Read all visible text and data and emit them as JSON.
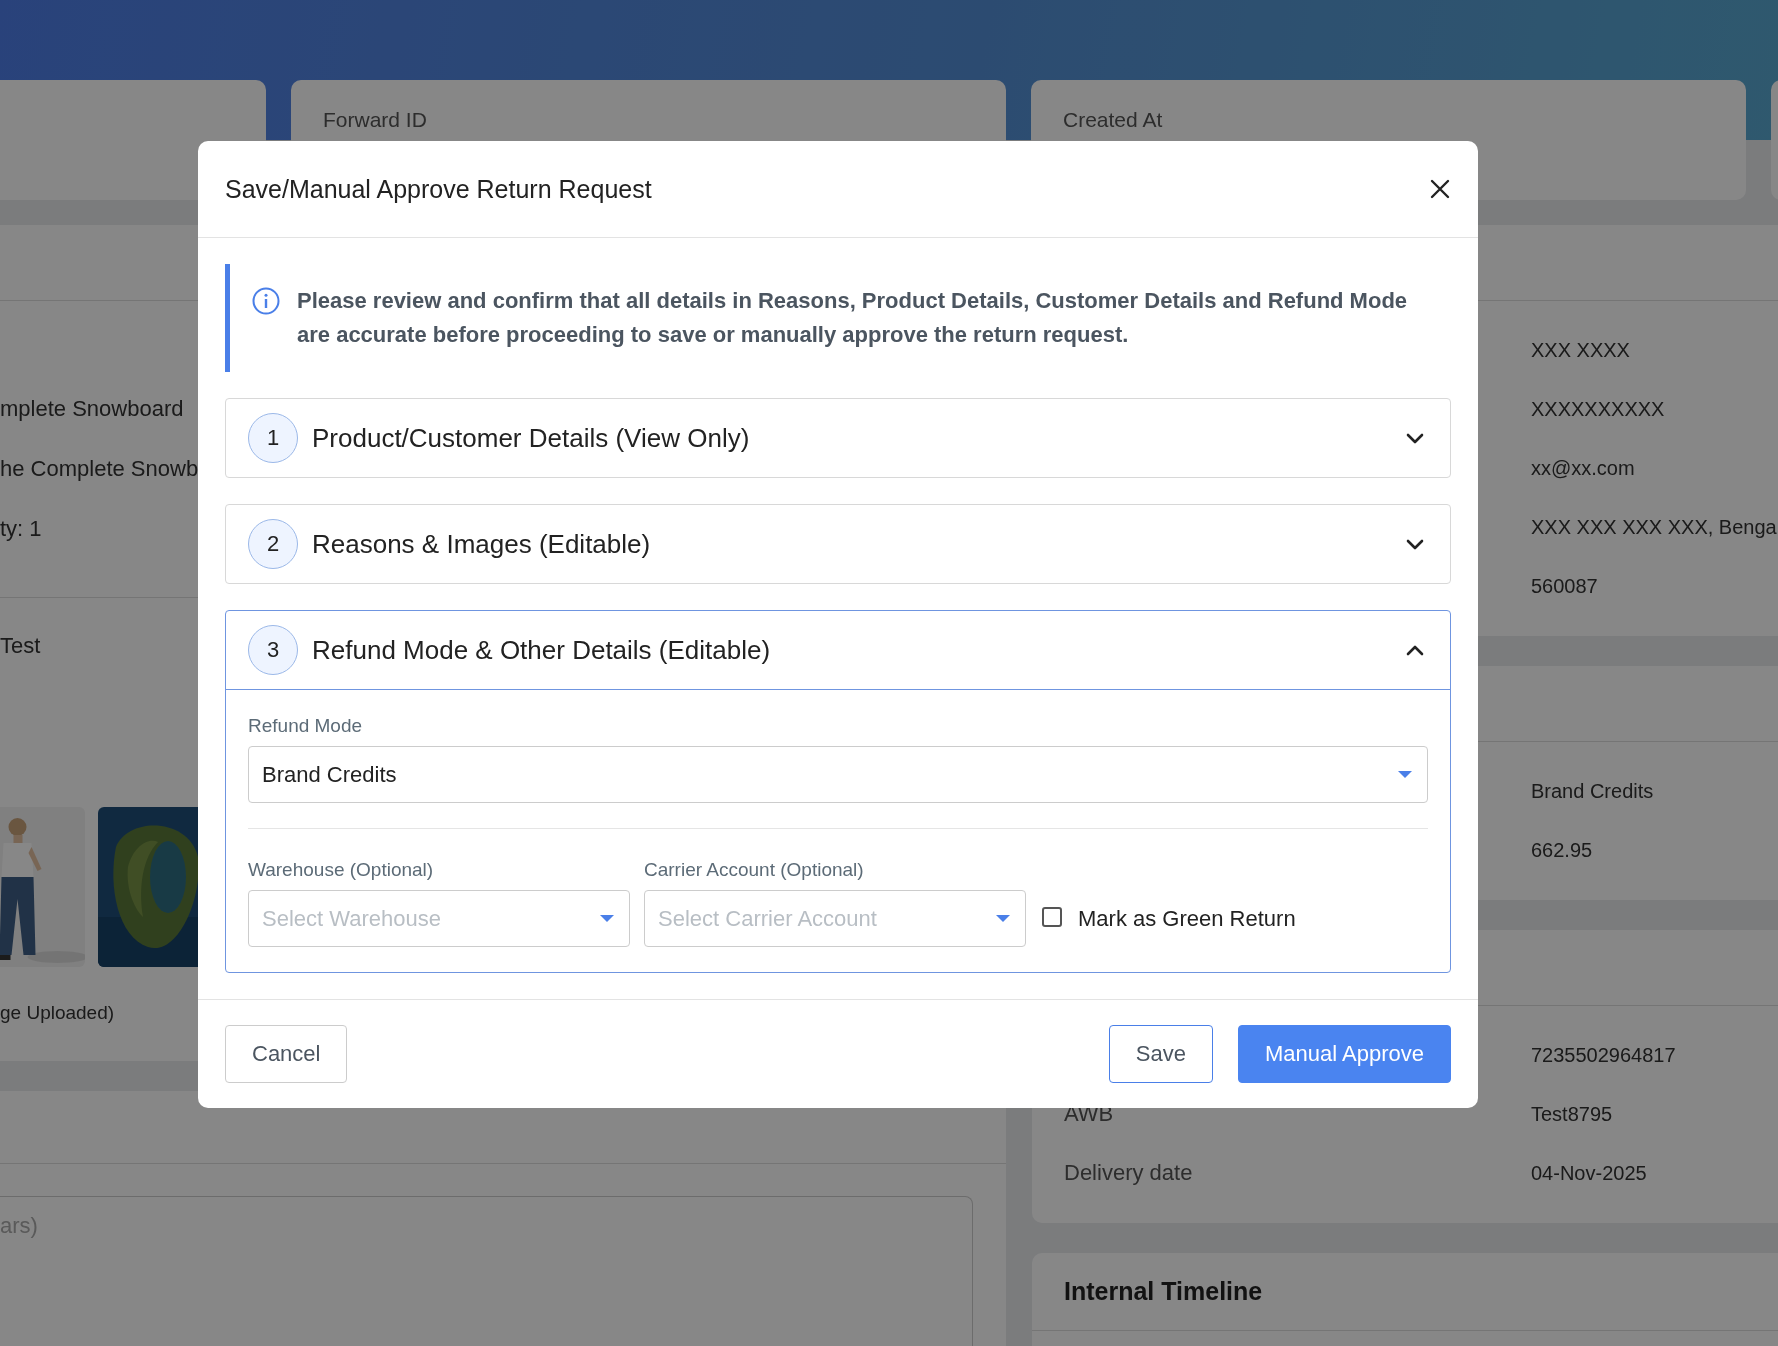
{
  "page": {
    "top_cards": [
      {
        "kind": "blank"
      },
      {
        "kind": "labeled",
        "label": "Forward ID"
      },
      {
        "kind": "labeled",
        "label": "Created At"
      },
      {
        "kind": "blank"
      }
    ],
    "product_lines": [
      "mplete Snowboard",
      "he Complete Snowb",
      "ty: 1"
    ],
    "reason": "Test",
    "images": [
      {
        "kind": "picture"
      },
      {
        "kind": "picture"
      }
    ],
    "images_caption": "ge Uploaded)",
    "comment": {
      "placeholder": "ars)"
    },
    "customer_values": [
      "XXX XXXX",
      "XXXXXXXXXX",
      "xx@xx.com",
      "XXX XXX XXX XXX, Benga",
      "560087"
    ],
    "refund_values": [
      "Brand Credits",
      "662.95"
    ],
    "shipping": [
      {
        "value": "7235502964817"
      },
      {
        "label": "AWB",
        "value": "Test8795"
      },
      {
        "label": "Delivery date",
        "value": "04-Nov-2025"
      }
    ],
    "timeline_title": "Internal Timeline"
  },
  "modal": {
    "title": "Save/Manual Approve Return Request",
    "info": "Please review and confirm that all details in Reasons, Product Details, Customer Details and Refund Mode are accurate before proceeding to save or manually approve the return request.",
    "sections": [
      {
        "number": "1",
        "title": "Product/Customer Details (View Only)",
        "expanded": false
      },
      {
        "number": "2",
        "title": "Reasons & Images (Editable)",
        "expanded": false
      },
      {
        "number": "3",
        "title": "Refund Mode & Other Details (Editable)",
        "expanded": true
      }
    ],
    "refund_mode": {
      "label": "Refund Mode",
      "value": "Brand Credits"
    },
    "warehouse": {
      "label": "Warehouse (Optional)",
      "placeholder": "Select Warehouse"
    },
    "carrier": {
      "label": "Carrier Account (Optional)",
      "placeholder": "Select Carrier Account"
    },
    "green_return": {
      "label": "Mark as Green Return",
      "checked": false
    },
    "buttons": [
      {
        "label": "Cancel",
        "kind": "secondary"
      },
      {
        "label": "Save",
        "kind": "outline"
      },
      {
        "label": "Manual Approve",
        "kind": "primary"
      }
    ]
  }
}
